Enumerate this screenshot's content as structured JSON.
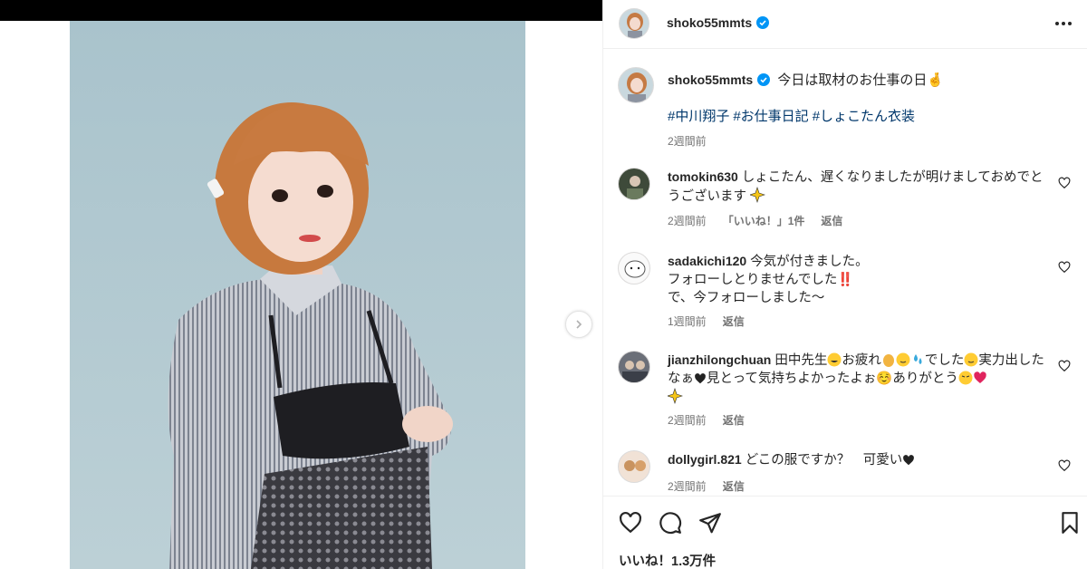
{
  "post": {
    "username": "shoko55mmts",
    "caption": "今日は取材のお仕事の日🤞",
    "hashtags": [
      "#中川翔子",
      "#お仕事日記",
      "#しょこたん衣装"
    ],
    "time": "2週間前"
  },
  "comments": [
    {
      "username": "tomokin630",
      "text": "しょこたん、遅くなりましたが明けましておめでとうございます",
      "emoji_tail": "sparkles",
      "time": "2週間前",
      "likes_label": "「いいね！」1件",
      "reply_label": "返信"
    },
    {
      "username": "sadakichi120",
      "lines": [
        "今気が付きました。",
        "フォローしとりませんでした‼️",
        "で、今フォローしました〜"
      ],
      "time": "1週間前",
      "reply_label": "返信"
    },
    {
      "username": "jianzhilongchuan",
      "text_parts": [
        "田中先生",
        "お疲れ",
        "",
        "でした",
        "実力出したなぁ",
        "見とって気持ちよかったよぉ☺️ありがとう",
        ""
      ],
      "time": "2週間前",
      "reply_label": "返信"
    },
    {
      "username": "dollygirl.821",
      "text": "どこの服ですか？　可愛い",
      "time": "2週間前",
      "reply_label": "返信"
    }
  ],
  "footer": {
    "likes": "いいね！1.3万件"
  },
  "colors": {
    "verified": "#0095f6",
    "hashtag": "#00376b",
    "muted": "#737373",
    "border": "#efefef"
  },
  "icons": [
    "verified-badge-icon",
    "more-options-icon",
    "heart-icon",
    "comment-icon",
    "share-icon",
    "bookmark-icon",
    "chevron-right-icon"
  ]
}
